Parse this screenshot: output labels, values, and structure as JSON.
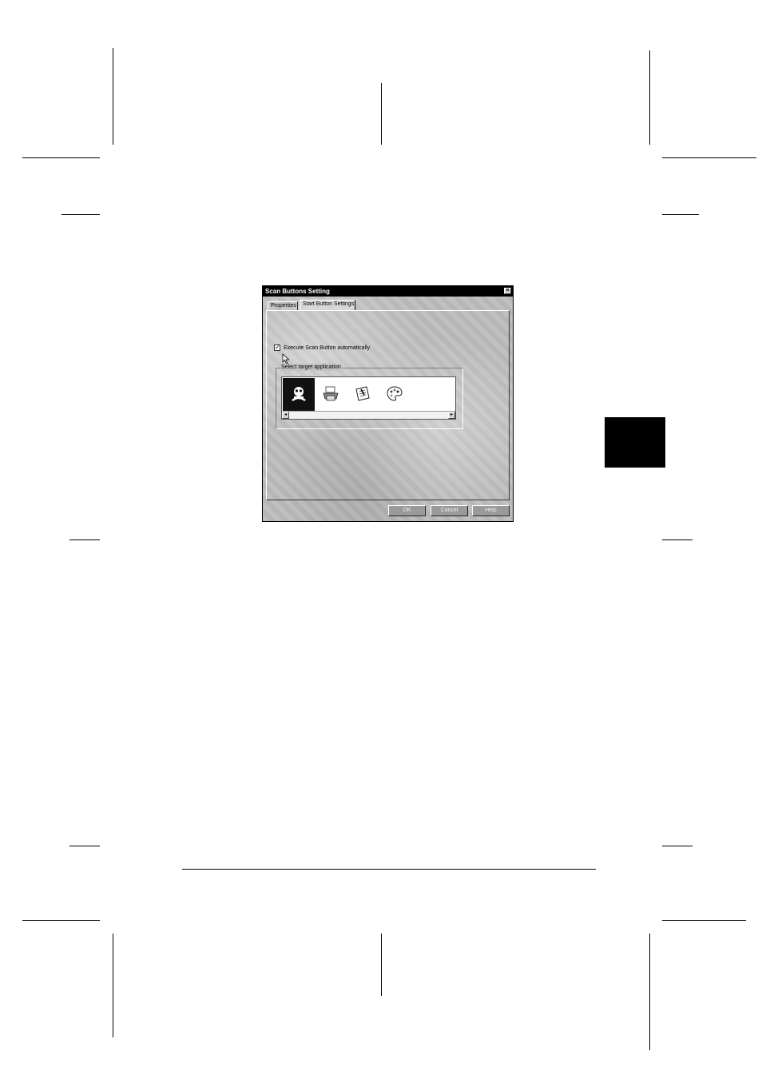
{
  "dialog": {
    "title": "Scan Buttons Setting",
    "close_glyph": "×",
    "tabs": [
      {
        "label": "Properties",
        "active": false
      },
      {
        "label": "Start Button Settings",
        "active": true
      }
    ],
    "checkbox": {
      "label": "Execute Scan Button automatically",
      "checked": true,
      "glyph": "✓"
    },
    "group_label": "Select target application",
    "apps": [
      {
        "icon": "scanner-app-icon",
        "selected": true
      },
      {
        "icon": "printer-icon",
        "selected": false
      },
      {
        "icon": "document-app-icon",
        "selected": false
      },
      {
        "icon": "paint-palette-icon",
        "selected": false
      }
    ],
    "scroll_left_glyph": "◂",
    "scroll_right_glyph": "▸",
    "buttons": {
      "ok": "OK",
      "cancel": "Cancel",
      "help": "Help"
    }
  },
  "colors": {
    "page_background": "#ffffff",
    "title_bar": "#000000",
    "tab_block": "#000000"
  }
}
